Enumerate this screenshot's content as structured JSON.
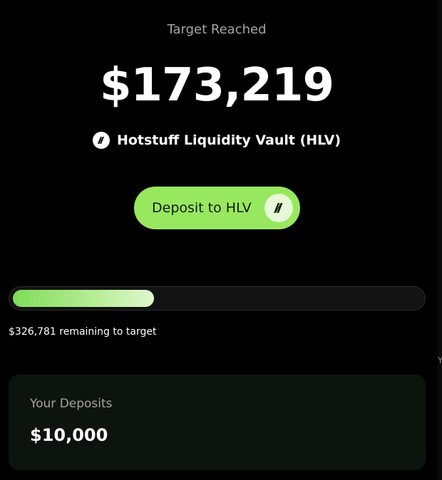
{
  "header": {
    "status_label": "Target Reached",
    "amount": "$173,219"
  },
  "vault": {
    "name": "Hotstuff Liquidity Vault (HLV)",
    "logo_icon": "hotstuff-logo-icon"
  },
  "deposit_button": {
    "label": "Deposit to HLV",
    "icon": "hotstuff-logo-icon"
  },
  "progress": {
    "fraction": 0.346,
    "remaining_text": "$326,781 remaining to target"
  },
  "deposits_card": {
    "title": "Your Deposits",
    "value": "$10,000"
  },
  "colors": {
    "background": "#000000",
    "accent_green": "#98e85f",
    "card_background": "#0d140d"
  }
}
